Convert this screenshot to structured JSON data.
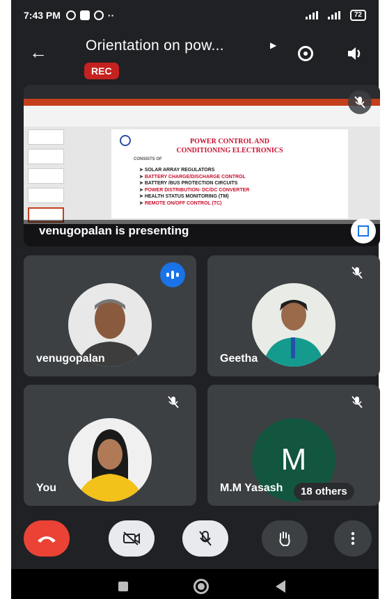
{
  "status_bar": {
    "time": "7:43 PM",
    "battery": "72"
  },
  "header": {
    "title": "Orientation on pow...",
    "rec_badge": "REC"
  },
  "presentation": {
    "presenter_label": "venugopalan is presenting",
    "slide": {
      "title_line1": "POWER CONTROL AND",
      "title_line2": "CONDITIONING ELECTRONICS",
      "subtitle": "CONSISTS OF",
      "bullets": [
        "SOLAR ARRAY REGULATORS",
        "BATTERY CHARGE/DISCHARGE CONTROL",
        "BATTERY /BUS PROTECTION CIRCUITS",
        "POWER DISTRIBUTION- DC/DC CONVERTER",
        "HEALTH STATUS MONITORING (TM)",
        "REMOTE ON/OFF CONTROL (TC)"
      ],
      "bullet_colors": [
        "#1a1a1a",
        "#c8102e",
        "#1a1a1a",
        "#c8102e",
        "#1a1a1a",
        "#c8102e"
      ]
    }
  },
  "participants": [
    {
      "name": "venugopalan"
    },
    {
      "name": "Geetha"
    },
    {
      "name": "You"
    },
    {
      "name": "M.M Yasash",
      "initial": "M"
    }
  ],
  "others_chip": "18 others",
  "colors": {
    "background": "#202124",
    "tile": "#3c4043",
    "end_call": "#ea4335",
    "rec": "#c5221f",
    "speaking": "#1a73e8",
    "m_avatar": "#13563f"
  }
}
